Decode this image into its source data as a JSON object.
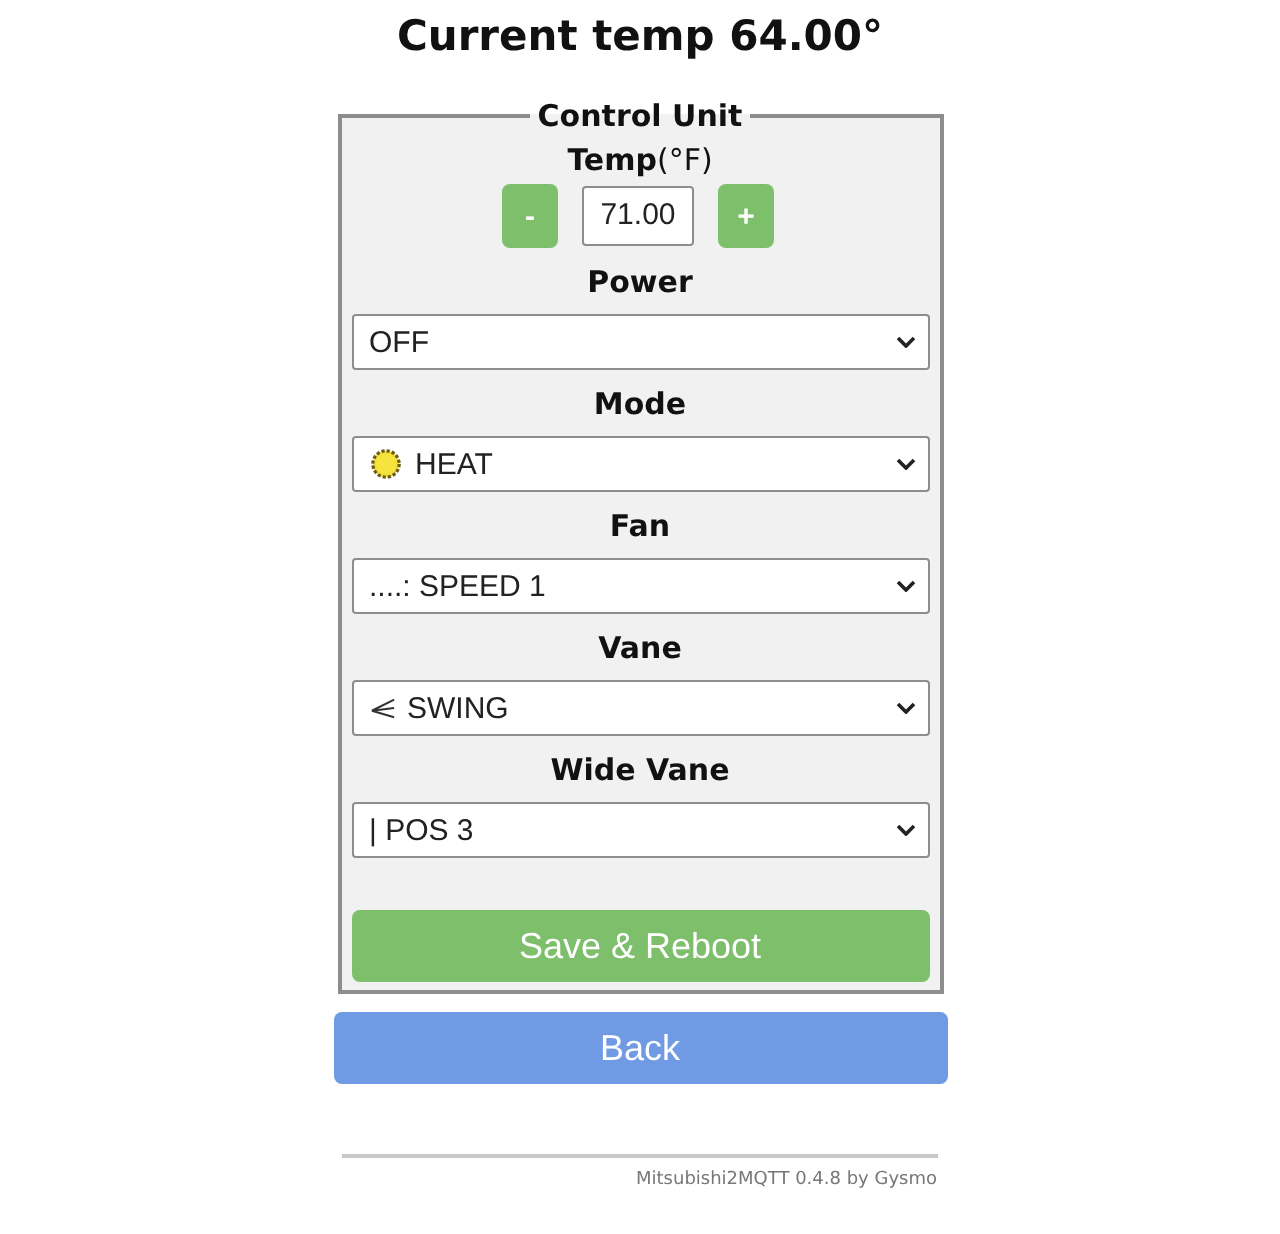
{
  "heading": "Current temp 64.00°",
  "control_unit": {
    "legend": "Control Unit",
    "temp": {
      "label": "**Temp**(°F)",
      "decrease": "-",
      "value": "71.00",
      "increase": "+"
    },
    "fields": [
      {
        "label": "Power",
        "kind": "plain",
        "value": "OFF"
      },
      {
        "label": "Mode",
        "kind": "sun",
        "value": "HEAT"
      },
      {
        "label": "Fan",
        "kind": "plain",
        "value": "....: SPEED 1"
      },
      {
        "label": "Vane",
        "kind": "lines",
        "value": "SWING"
      },
      {
        "label": "Wide Vane",
        "kind": "plain",
        "value": "| POS 3"
      }
    ],
    "save_button": "Save & Reboot"
  },
  "back_button": "Back",
  "footer": "Mitsubishi2MQTT 0.4.8 by Gysmo"
}
